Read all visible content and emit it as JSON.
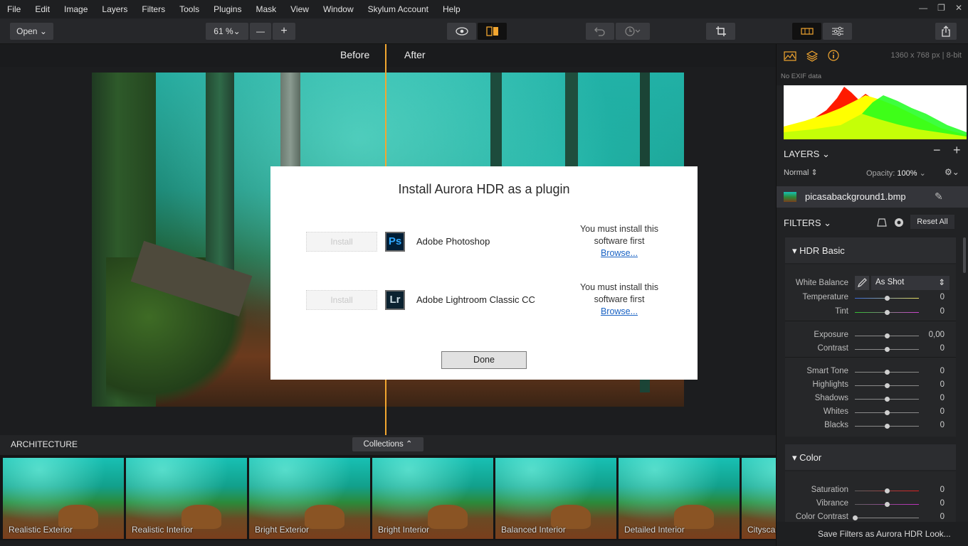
{
  "menu": [
    "File",
    "Edit",
    "Image",
    "Layers",
    "Filters",
    "Tools",
    "Plugins",
    "Mask",
    "View",
    "Window",
    "Skylum Account",
    "Help"
  ],
  "window_controls": [
    "—",
    "❐",
    "✕"
  ],
  "toolbar": {
    "open_label": "Open ⌄",
    "zoom_label": "61 %⌄",
    "zoom_out": "—",
    "zoom_in": "+"
  },
  "compare": {
    "before": "Before",
    "after": "After"
  },
  "dialog": {
    "title": "Install Aurora HDR as a plugin",
    "rows": [
      {
        "install": "Install",
        "icon": "Ps",
        "app": "Adobe Photoshop",
        "req_line1": "You must install this",
        "req_line2": "software first",
        "browse": "Browse..."
      },
      {
        "install": "Install",
        "icon": "Lr",
        "app": "Adobe Lightroom Classic CC",
        "req_line1": "You must install this",
        "req_line2": "software first",
        "browse": "Browse..."
      }
    ],
    "done": "Done"
  },
  "strip": {
    "title": "ARCHITECTURE",
    "collections": "Collections ⌃",
    "looks": [
      "Realistic Exterior",
      "Realistic Interior",
      "Bright Exterior",
      "Bright Interior",
      "Balanced Interior",
      "Detailed Interior",
      "Cityscape"
    ]
  },
  "info": {
    "dimensions": "1360 x 768 px",
    "sep": "|",
    "bitdepth": "8-bit",
    "exif": "No EXIF data"
  },
  "layers": {
    "title": "LAYERS",
    "blend": "Normal",
    "opacity_label": "Opacity:",
    "opacity_value": "100%",
    "layer_name": "picasabackground1.bmp"
  },
  "filters": {
    "title": "FILTERS",
    "reset_all": "Reset All",
    "hdr_basic": {
      "title": "HDR Basic",
      "white_balance_label": "White Balance",
      "white_balance_value": "As Shot",
      "rows": [
        {
          "label": "Temperature",
          "value": "0",
          "pos": 0.5
        },
        {
          "label": "Tint",
          "value": "0",
          "pos": 0.5
        },
        {
          "label": "Exposure",
          "value": "0,00",
          "pos": 0.5
        },
        {
          "label": "Contrast",
          "value": "0",
          "pos": 0.5
        },
        {
          "label": "Smart Tone",
          "value": "0",
          "pos": 0.5
        },
        {
          "label": "Highlights",
          "value": "0",
          "pos": 0.5
        },
        {
          "label": "Shadows",
          "value": "0",
          "pos": 0.5
        },
        {
          "label": "Whites",
          "value": "0",
          "pos": 0.5
        },
        {
          "label": "Blacks",
          "value": "0",
          "pos": 0.5
        }
      ]
    },
    "color": {
      "title": "Color",
      "rows": [
        {
          "label": "Saturation",
          "value": "0",
          "pos": 0.5
        },
        {
          "label": "Vibrance",
          "value": "0",
          "pos": 0.5
        },
        {
          "label": "Color Contrast",
          "value": "0",
          "pos": 0.0
        }
      ]
    },
    "save_look": "Save Filters as Aurora HDR Look..."
  },
  "colors": {
    "accent": "#f2a630",
    "dialog_bg": "#ffffff",
    "panel_bg": "#212224"
  }
}
